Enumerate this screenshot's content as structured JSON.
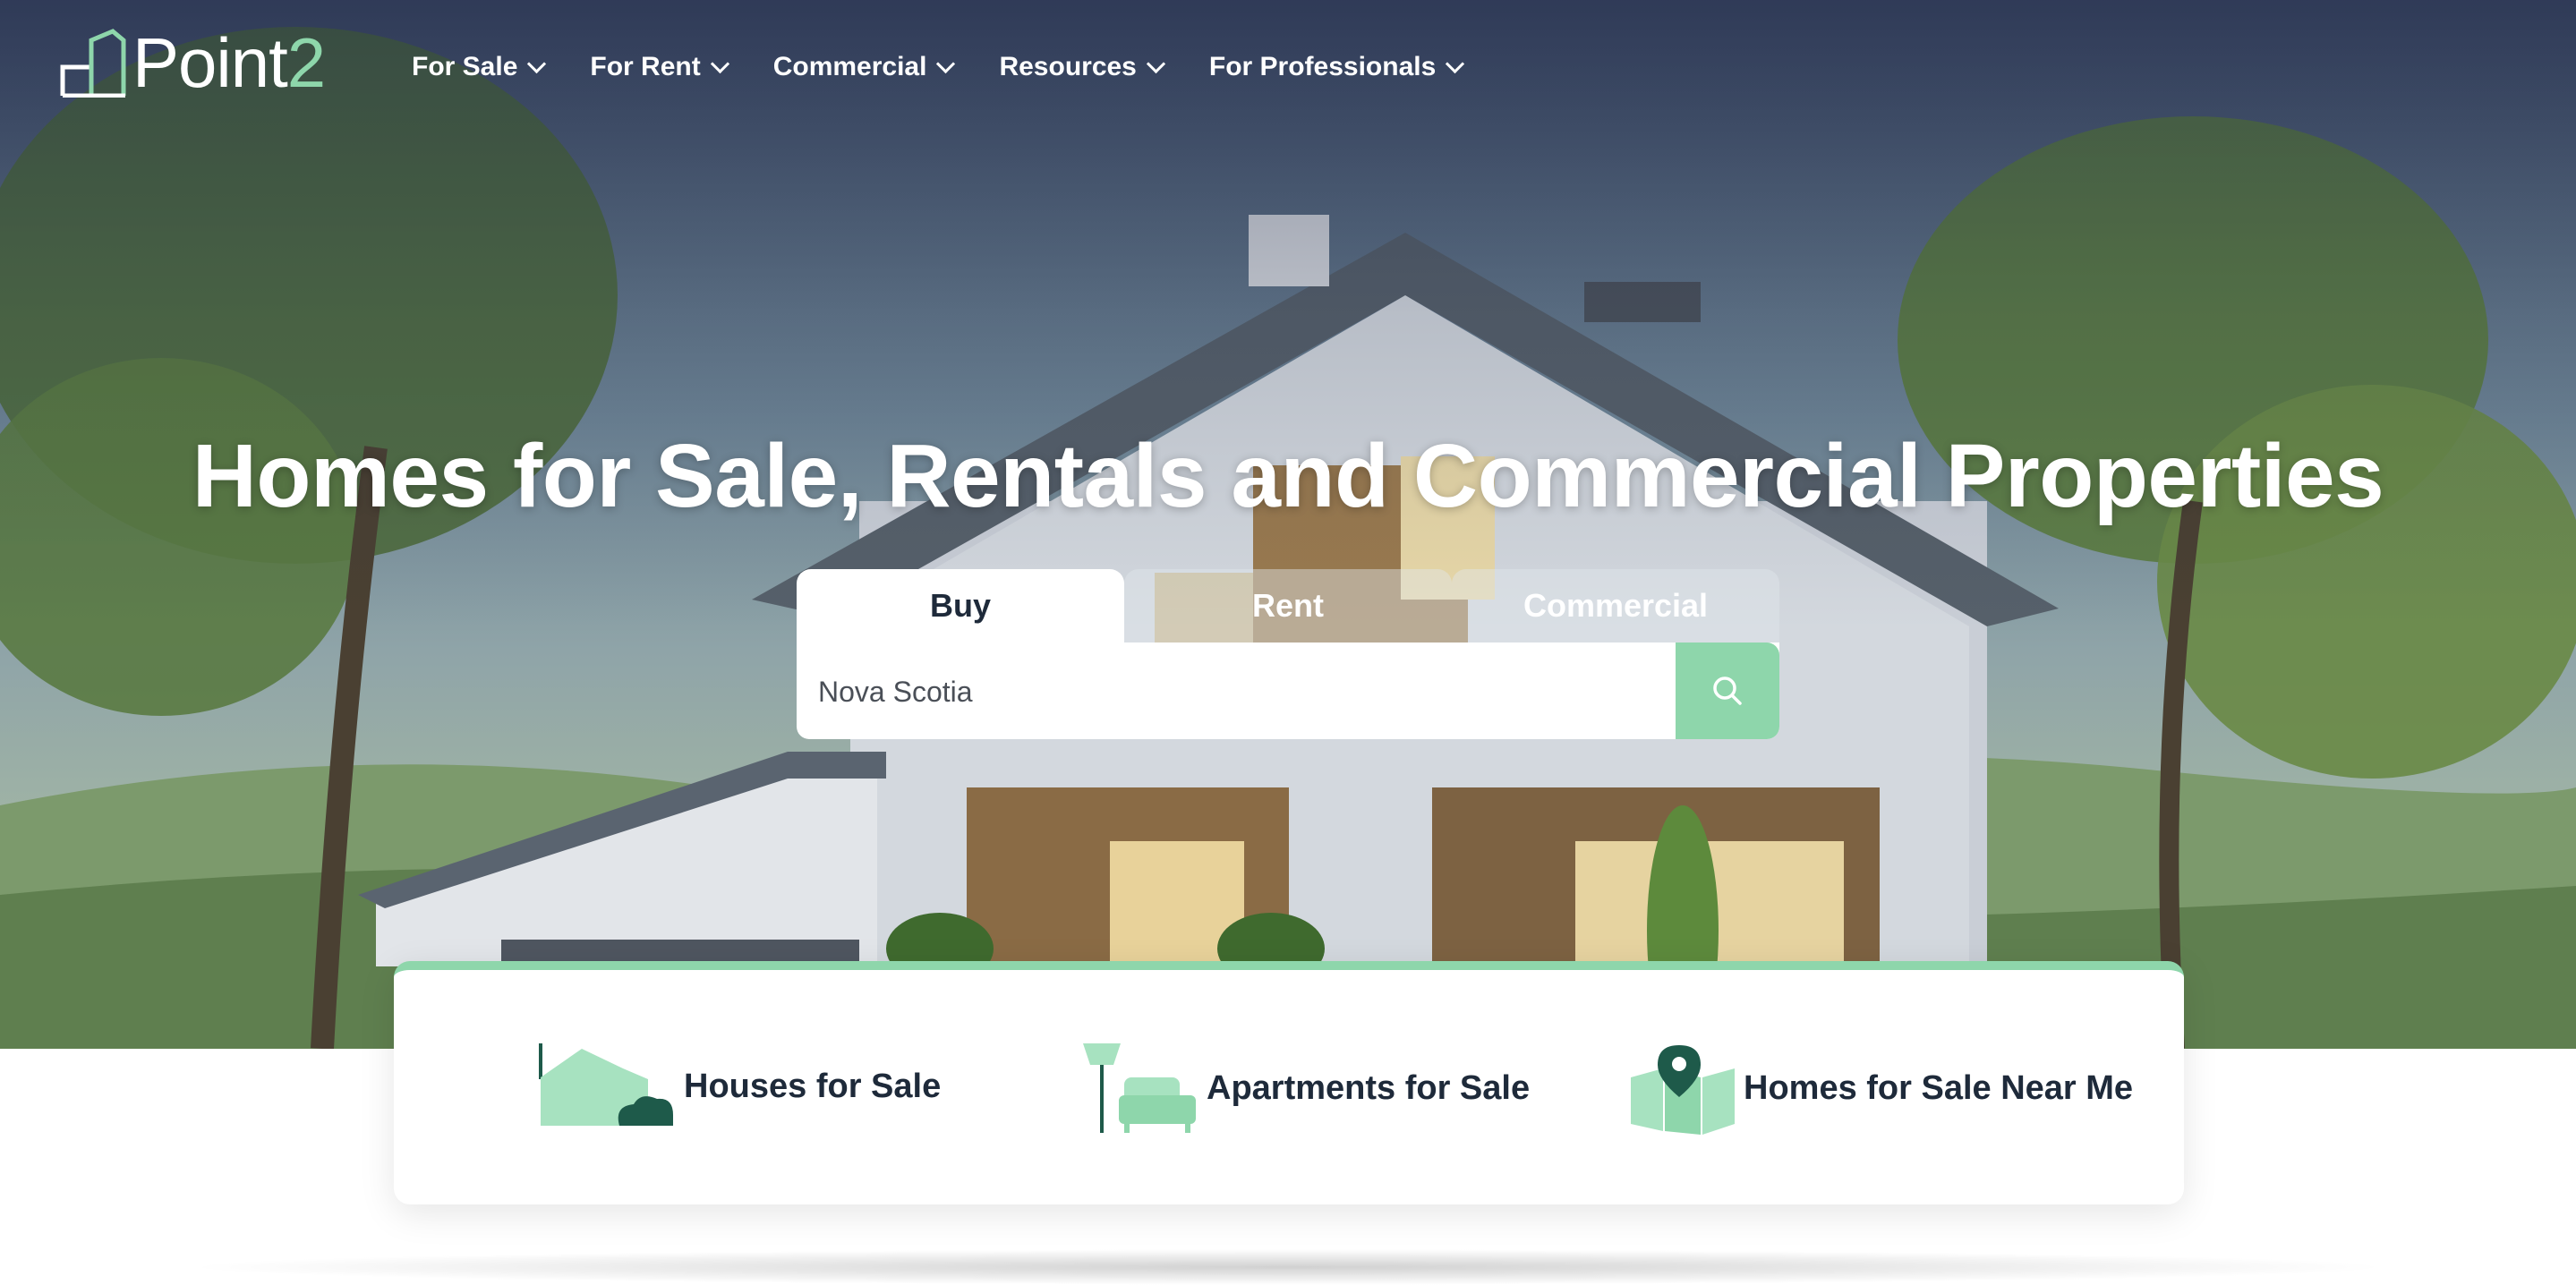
{
  "brand": {
    "name_main": "Point",
    "name_accent": "2",
    "accent_color": "#8ed6ab"
  },
  "nav": {
    "items": [
      {
        "label": "For Sale"
      },
      {
        "label": "For Rent"
      },
      {
        "label": "Commercial"
      },
      {
        "label": "Resources"
      },
      {
        "label": "For Professionals"
      }
    ]
  },
  "hero": {
    "headline": "Homes for Sale, Rentals and Commercial Properties"
  },
  "search": {
    "tabs": [
      {
        "label": "Buy",
        "active": true
      },
      {
        "label": "Rent",
        "active": false
      },
      {
        "label": "Commercial",
        "active": false
      }
    ],
    "value": "Nova Scotia",
    "button_icon": "search-icon"
  },
  "quick_links": [
    {
      "label": "Houses for Sale",
      "icon": "house-icon"
    },
    {
      "label": "Apartments for Sale",
      "icon": "apartment-furniture-icon"
    },
    {
      "label": "Homes for Sale Near Me",
      "icon": "map-pin-icon"
    }
  ]
}
